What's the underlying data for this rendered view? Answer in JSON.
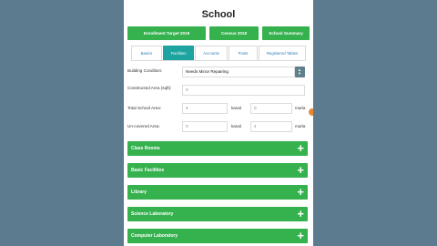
{
  "header": {
    "title": "School"
  },
  "top_buttons": [
    "Enrollment Target 2019",
    "Census 2018",
    "School Summary"
  ],
  "tabs": [
    "Basics",
    "Facilities",
    "Accounts",
    "Posts",
    "Registered Tables"
  ],
  "active_tab": "Facilities",
  "form": {
    "building_condition": {
      "label": "Building Condition:",
      "value": "Needs Minor Repairing"
    },
    "constructed_area": {
      "label": "Constructed Area (sqft):",
      "value": "0"
    },
    "total_school_area": {
      "label": "Total School Area:",
      "kanal_value": "4",
      "kanal_unit": "kanal",
      "marla_value": "0",
      "marla_unit": "marla"
    },
    "uncovered_area": {
      "label": "Un-covered Area:",
      "kanal_value": "0",
      "kanal_unit": "kanal",
      "marla_value": "4",
      "marla_unit": "marla"
    }
  },
  "sections": [
    "Class Rooms",
    "Basic Facilities",
    "Library",
    "Science Laboratory",
    "Computer Laboratory"
  ],
  "colors": {
    "accent_green": "#35b14e",
    "active_tab": "#1da3a0",
    "background": "#5d7b8f"
  }
}
